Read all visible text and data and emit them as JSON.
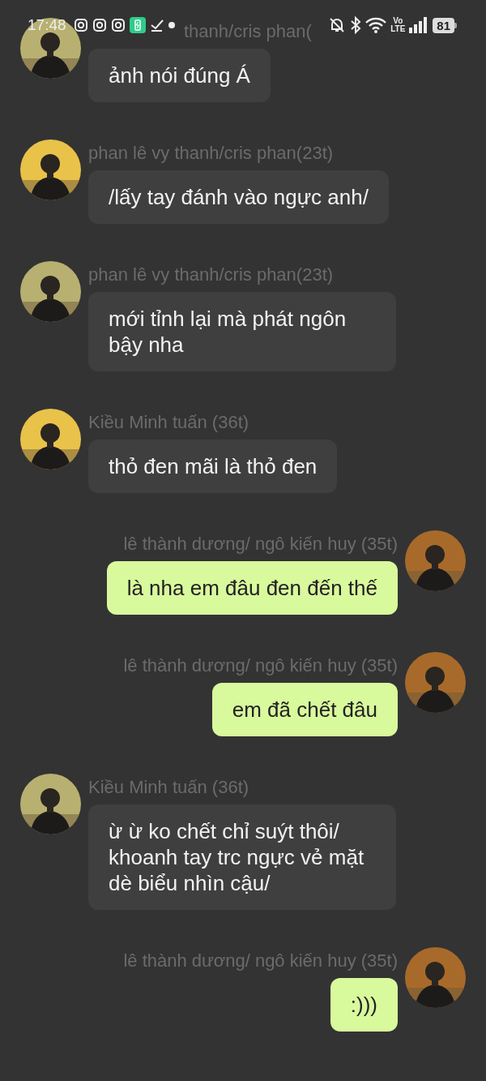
{
  "status_bar": {
    "time": "17:48",
    "volte": "Vo",
    "lte": "LTE",
    "battery": "81"
  },
  "messages": [
    {
      "kind": "received",
      "name": "thanh/cris phan(",
      "text": "ảnh nói đúng Á"
    },
    {
      "kind": "received",
      "name": "phan lê vy thanh/cris phan(23t)",
      "text": "/lấy tay đánh vào ngực anh/"
    },
    {
      "kind": "received",
      "name": "phan lê vy thanh/cris phan(23t)",
      "text": "mới tỉnh lại mà phát ngôn bậy nha"
    },
    {
      "kind": "received",
      "name": "Kiều Minh tuấn (36t)",
      "text": "thỏ đen mãi là thỏ đen"
    },
    {
      "kind": "sent",
      "name": "lê thành dương/ ngô kiến huy (35t)",
      "text": "là nha em đâu đen đến thế"
    },
    {
      "kind": "sent",
      "name": "lê thành dương/ ngô kiến huy (35t)",
      "text": "em đã chết đâu"
    },
    {
      "kind": "received",
      "name": "Kiều Minh tuấn (36t)",
      "text": "ừ ừ ko chết chỉ suýt thôi/ khoanh tay trc ngực vẻ mặt dè biểu nhìn cậu/"
    },
    {
      "kind": "sent",
      "name": "lê thành dương/ ngô kiến huy (35t)",
      "text": ":)))"
    }
  ]
}
